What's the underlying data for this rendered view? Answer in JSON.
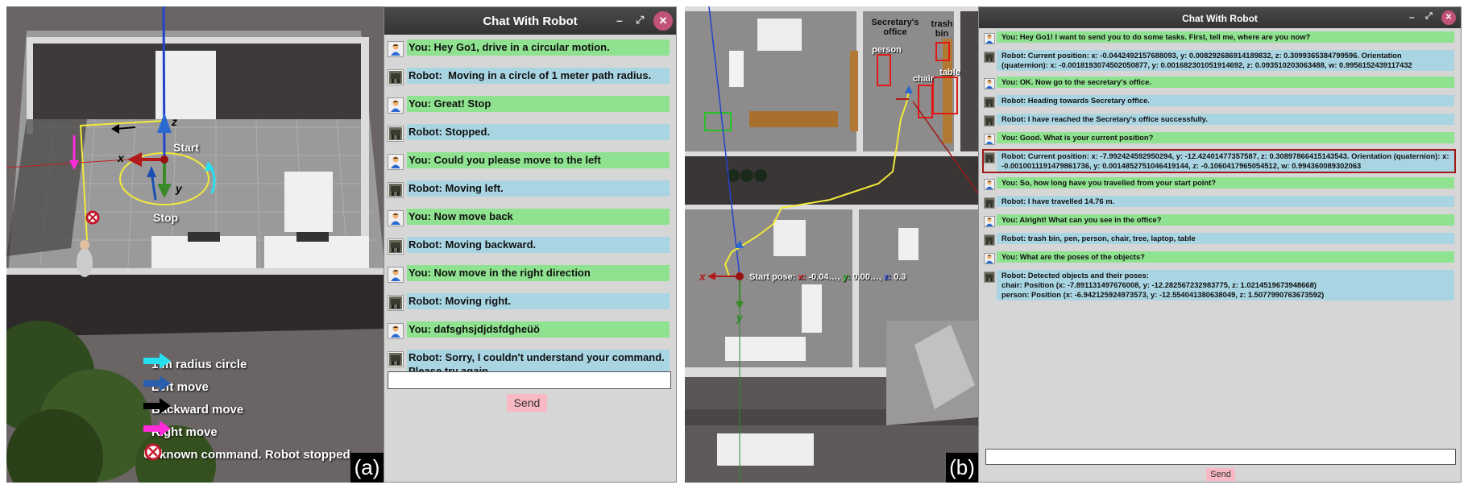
{
  "left_scene": {
    "axis_labels": {
      "x": "x",
      "y": "y",
      "z": "z"
    },
    "start_label": "Start",
    "stop_label": "Stop",
    "legend": [
      {
        "text": "1 m radius circle",
        "color": "#26e0f0",
        "icon": "cyan-arrow-icon"
      },
      {
        "text": "Left move",
        "color": "#2a5fb0",
        "icon": "blue-arrow-icon"
      },
      {
        "text": "Backward move",
        "color": "#000000",
        "icon": "black-arrow-icon"
      },
      {
        "text": "Right move",
        "color": "#ff2bd8",
        "icon": "magenta-arrow-icon"
      },
      {
        "text": "Unknown command. Robot stopped",
        "color": "#ffffff",
        "icon": "stop-sign-icon"
      }
    ],
    "panel_tag": "(a)"
  },
  "left_chat": {
    "title": "Chat With Robot",
    "controls": {
      "minimize": "–",
      "maximize": "⤢",
      "close": "✕"
    },
    "messages": [
      {
        "role": "you",
        "text": "You: Hey Go1, drive in a circular motion."
      },
      {
        "role": "robot",
        "text": "Robot:  Moving in a circle of 1 meter path radius."
      },
      {
        "role": "you",
        "text": "You: Great! Stop"
      },
      {
        "role": "robot",
        "text": "Robot: Stopped."
      },
      {
        "role": "you",
        "text": "You: Could you please move to the left"
      },
      {
        "role": "robot",
        "text": "Robot: Moving left."
      },
      {
        "role": "you",
        "text": "You: Now move back"
      },
      {
        "role": "robot",
        "text": "Robot: Moving backward."
      },
      {
        "role": "you",
        "text": "You: Now move in the right direction"
      },
      {
        "role": "robot",
        "text": "Robot: Moving right."
      },
      {
        "role": "you",
        "text": "You: dafsghsjdjdsfdgheüö"
      },
      {
        "role": "robot",
        "text": "Robot: Sorry, I couldn't understand your command. Please try again."
      }
    ],
    "input_value": "",
    "send_label": "Send"
  },
  "right_scene": {
    "labels": {
      "secretary_office": "Secretary's office",
      "trash_bin": "trash bin",
      "person": "person",
      "chair": "chair",
      "table": "table"
    },
    "start_pose_prefix": "Start pose:",
    "start_pose_x_key": "x:",
    "start_pose_x": "-0.04…,",
    "start_pose_y_key": "y:",
    "start_pose_y": "0.00…,",
    "start_pose_z_key": "z:",
    "start_pose_z": "0.3",
    "axis_labels": {
      "x": "x",
      "y": "y"
    },
    "panel_tag": "(b)"
  },
  "right_chat": {
    "title": "Chat With Robot",
    "controls": {
      "minimize": "–",
      "maximize": "⤢",
      "close": "✕"
    },
    "messages": [
      {
        "role": "you",
        "text": "You: Hey Go1! I want to send you to do some tasks. First, tell me, where are you now?"
      },
      {
        "role": "robot",
        "text": "Robot: Current position: x: -0.0442492157688093, y: 0.008292686914189832, z: 0.3099365384799596. Orientation (quaternion): x: -0.0018193074502050877, y: 0.001682301051914692, z: 0.093510203063488, w: 0.9956152439117432"
      },
      {
        "role": "you",
        "text": "You: OK. Now go to the secretary's office."
      },
      {
        "role": "robot",
        "text": "Robot: Heading towards Secretary office."
      },
      {
        "role": "robot",
        "text": "Robot: I have reached the Secretary's office successfully."
      },
      {
        "role": "you",
        "text": "You: Good. What is your current position?"
      },
      {
        "role": "robot",
        "text": "Robot: Current position: x: -7.992424592950294, y: -12.42401477357587, z: 0.30897866415143543. Orientation (quaternion): x: -0.0010011191479861736, y: 0.0014852751046419144, z: -0.1060417965054512, w: 0.994360089302063",
        "highlight": true
      },
      {
        "role": "you",
        "text": "You: So, how long have you travelled from your start point?"
      },
      {
        "role": "robot",
        "text": "Robot: I have travelled 14.76 m."
      },
      {
        "role": "you",
        "text": "You: Alright! What can you see in the office?"
      },
      {
        "role": "robot",
        "text": "Robot: trash bin, pen, person, chair, tree, laptop, table"
      },
      {
        "role": "you",
        "text": "You: What are the poses of the objects?"
      },
      {
        "role": "robot",
        "text": "Robot: Detected objects and their poses:\nchair: Position (x: -7.891131497676008, y: -12.282567232983775, z: 1.0214519673948668)\nperson: Position (x: -6.942125924973573, y: -12.554041380638049, z: 1.5077990763673592)"
      }
    ],
    "input_value": "",
    "send_label": "Send"
  }
}
